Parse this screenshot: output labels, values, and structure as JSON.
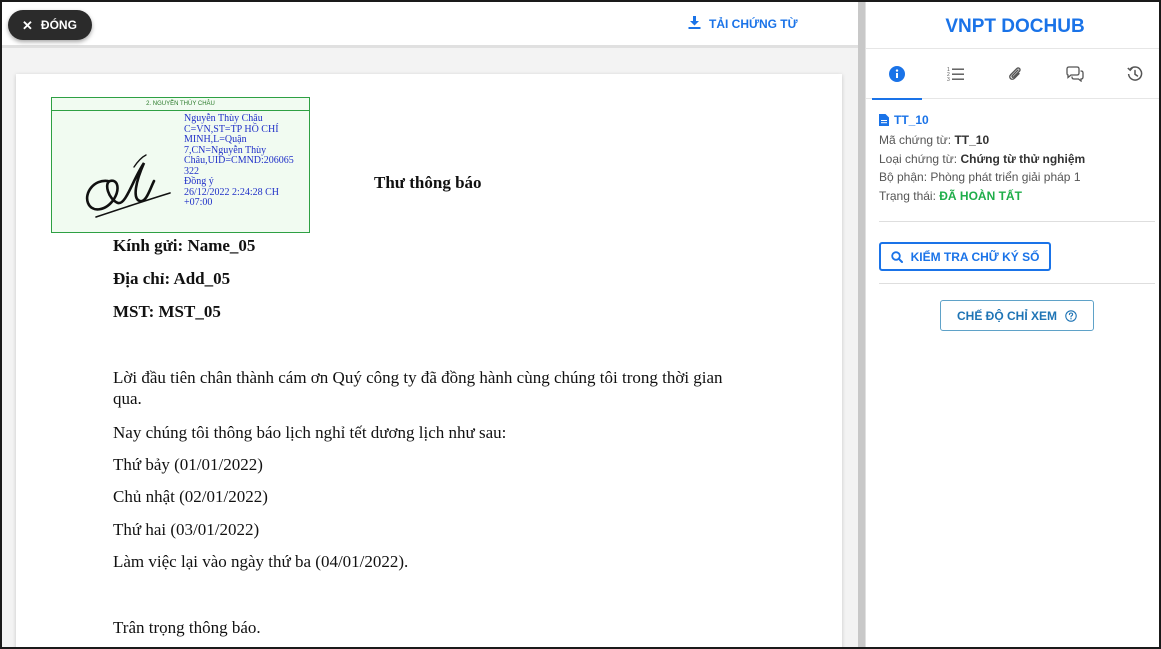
{
  "toolbar": {
    "close_label": "ĐÓNG",
    "download_label": "TẢI CHỨNG TỪ"
  },
  "signature": {
    "header": "2. NGUYỄN THÙY CHÂU",
    "lines": [
      "Nguyễn Thùy Châu",
      "C=VN,ST=TP HỒ CHÍ",
      "MINH,L=Quận",
      "7,CN=Nguyễn Thùy",
      "Châu,UID=CMND:206065",
      "322",
      "Đồng ý",
      "26/12/2022 2:24:28 CH",
      "+07:00"
    ]
  },
  "document": {
    "title": "Thư thông báo",
    "recipient": "Kính gửi: Name_05",
    "address": "Địa chỉ: Add_05",
    "tax_code": "MST: MST_05",
    "paragraphs": [
      "Lời đầu tiên chân thành cám ơn Quý công ty đã đồng hành cùng chúng tôi trong thời gian qua.",
      "Nay chúng tôi thông báo lịch nghỉ tết dương lịch như sau:",
      "Thứ bảy (01/01/2022)",
      "Chủ nhật (02/01/2022)",
      "Thứ hai (03/01/2022)",
      "Làm việc lại vào ngày thứ ba (04/01/2022).",
      "Trân trọng thông báo."
    ]
  },
  "panel": {
    "brand": "VNPT DOCHUB",
    "tabs": [
      {
        "icon": "info-icon",
        "active": true
      },
      {
        "icon": "ordered-list-icon",
        "active": false
      },
      {
        "icon": "paperclip-icon",
        "active": false
      },
      {
        "icon": "comments-icon",
        "active": false
      },
      {
        "icon": "history-icon",
        "active": false
      }
    ],
    "doc_code_title": "TT_10",
    "fields": [
      {
        "label": "Mã chứng từ: ",
        "value": "TT_10"
      },
      {
        "label": "Loại chứng từ: ",
        "value": "Chứng từ thử nghiệm"
      },
      {
        "label": "Bộ phận: ",
        "value": "Phòng phát triển giải pháp 1"
      },
      {
        "label": "Trạng thái: ",
        "value": "ĐÃ HOÀN TẤT"
      }
    ],
    "verify_label": "KIỂM TRA CHỮ KÝ SỐ",
    "view_mode_label": "CHẾ ĐỘ CHỈ XEM"
  },
  "colors": {
    "accent": "#1a73e8",
    "status_done": "#1fae4a",
    "signature_text": "#2030c8",
    "signature_border": "#2ea043"
  }
}
